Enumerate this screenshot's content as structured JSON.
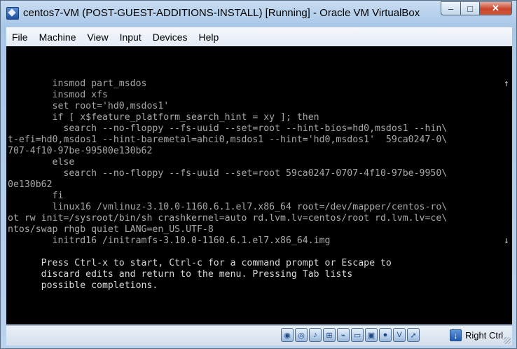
{
  "window": {
    "title": "centos7-VM (POST-GUEST-ADDITIONS-INSTALL) [Running] - Oracle VM VirtualBox",
    "controls": {
      "minimize": "‒",
      "maximize": "□",
      "close": "✕"
    }
  },
  "menu": {
    "items": [
      "File",
      "Machine",
      "View",
      "Input",
      "Devices",
      "Help"
    ]
  },
  "console": {
    "lines": [
      "        insmod part_msdos",
      "        insmod xfs",
      "        set root='hd0,msdos1'",
      "        if [ x$feature_platform_search_hint = xy ]; then",
      "          search --no-floppy --fs-uuid --set=root --hint-bios=hd0,msdos1 --hin\\",
      "t-efi=hd0,msdos1 --hint-baremetal=ahci0,msdos1 --hint='hd0,msdos1'  59ca0247-0\\",
      "707-4f10-97be-99500e130b62",
      "        else",
      "          search --no-floppy --fs-uuid --set=root 59ca0247-0707-4f10-97be-9950\\",
      "0e130b62",
      "        fi",
      "        linux16 /vmlinuz-3.10.0-1160.6.1.el7.x86_64 root=/dev/mapper/centos-ro\\",
      "ot rw init=/sysroot/bin/sh crashkernel=auto rd.lvm.lv=centos/root rd.lvm.lv=ce\\",
      "ntos/swap rhgb quiet LANG=en_US.UTF-8",
      "        initrd16 /initramfs-3.10.0-1160.6.1.el7.x86_64.img"
    ],
    "scroll_up": "↑",
    "scroll_down": "↓",
    "help_lines": [
      "      Press Ctrl-x to start, Ctrl-c for a command prompt or Escape to",
      "      discard edits and return to the menu. Pressing Tab lists",
      "      possible completions."
    ]
  },
  "statusbar": {
    "icons": [
      "hard-disk-icon",
      "optical-drive-icon",
      "audio-icon",
      "network-icon",
      "usb-icon",
      "shared-folders-icon",
      "display-icon",
      "video-capture-icon",
      "virtualization-icon",
      "mouse-integration-icon"
    ],
    "host_key_label": "Right Ctrl"
  },
  "colors": {
    "console_bg": "#000000",
    "console_text": "#a8a8a8",
    "console_text_bright": "#d8d8d8"
  }
}
